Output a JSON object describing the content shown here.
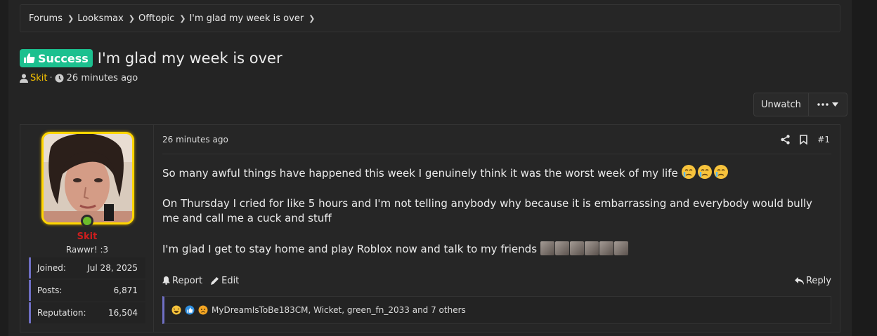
{
  "breadcrumb": [
    "Forums",
    "Looksmax",
    "Offtopic",
    "I'm glad my week is over"
  ],
  "thread": {
    "prefix": "Success",
    "title": "I'm glad my week is over",
    "author": "Skit",
    "time": "26 minutes ago"
  },
  "actions": {
    "watch_label": "Unwatch"
  },
  "user": {
    "name": "Skit",
    "title": "Rawwr! :3",
    "stats": [
      {
        "label": "Joined:",
        "value": "Jul 28, 2025"
      },
      {
        "label": "Posts:",
        "value": "6,871"
      },
      {
        "label": "Reputation:",
        "value": "16,504"
      }
    ]
  },
  "post": {
    "time": "26 minutes ago",
    "number": "#1",
    "paragraphs": [
      "So many awful things have happened this week I genuinely think it was the worst week of my life",
      "On Thursday I cried for like 5 hours and I'm not telling anybody why because it is embarrassing and everybody would bully me and call me a cuck and stuff",
      "I'm glad I get to stay home and play Roblox now and talk to my friends"
    ],
    "report_label": "Report",
    "edit_label": "Edit",
    "reply_label": "Reply",
    "reactions_text": "MyDreamIsToBe183CM, Wicket, green_fn_2033 and 7 others"
  },
  "colors": {
    "prefix_bg": "#1cc08f",
    "author": "#f6c100",
    "username_banned": "#cc1e1e",
    "avatar_border": "#ffd500",
    "online": "#6cbd2b",
    "accent_bar": "#6f6fc4"
  }
}
